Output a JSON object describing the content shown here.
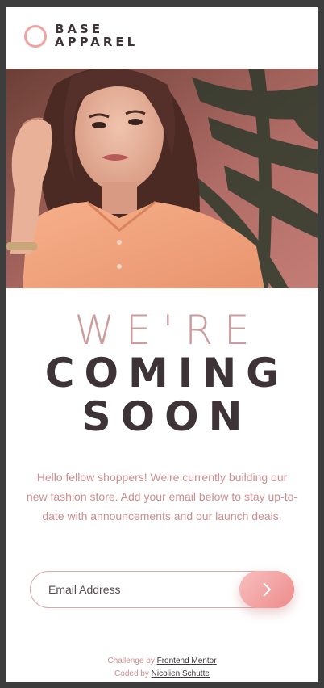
{
  "brand": {
    "line1": "BASE",
    "line2": "APPAREL",
    "accent": "#eea3a3"
  },
  "hero": {
    "icon": "hero-photo"
  },
  "headline": {
    "light": "WE'RE",
    "bold_line1": "COMING",
    "bold_line2": "SOON"
  },
  "description": "Hello fellow shoppers! We're currently building our new fashion store. Add your email below to stay up-to-date with announcements and our launch deals.",
  "form": {
    "email_placeholder": "Email Address",
    "submit_icon": "chevron-right-icon"
  },
  "footer": {
    "challenge_prefix": "Challenge by",
    "challenge_link": "Frontend Mentor",
    "coded_prefix": "Coded by",
    "coded_link": "Nicolien Schutte"
  },
  "colors": {
    "primary": "#cd8f8f",
    "dark": "#3e3337",
    "gradient_start": "#f8bfbf",
    "gradient_end": "#ee8b8b"
  }
}
